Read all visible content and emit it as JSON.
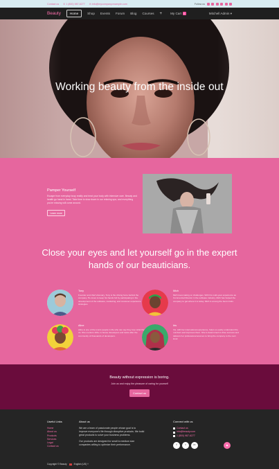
{
  "topbar": {
    "contact_label": "Contact us",
    "phone": "1 (800) 987-6277",
    "email": "info@mycompany.example.com",
    "follow_label": "Follow us"
  },
  "navbar": {
    "brand": "Beauty",
    "items": [
      "Home",
      "Shop",
      "Events",
      "Forum",
      "Blog",
      "Courses"
    ],
    "plus": "+",
    "cart_label": "My Cart",
    "cart_count": "0",
    "user": "Mitchell Admin"
  },
  "hero": {
    "title": "Working beauty from the inside out"
  },
  "pamper": {
    "title": "Pamper Yourself",
    "text": "Escape from everyday busy reality and treat your body with intensive care. Beauty and health go hand in hand. Take time to slow down in our relaxing spa, and everything you're missing will come around.",
    "button": "Learn more"
  },
  "quote": "Close your eyes and let yourself go in the expert hands of our beauticians.",
  "team": [
    {
      "name": "Tony",
      "desc": "Founder and chief visionary, Tony is the driving force behind the company. He loves to keep his hands full by participating in the development of the software, marketing, and customer experience strategies."
    },
    {
      "name": "Mich",
      "desc": "Mich loves taking on challenges. With his multi-year experience as Commercial Director in the software industry, Mich has helped the company to get where it is today. Mich is among the best minds."
    },
    {
      "name": "Aline",
      "desc": "Aline is one of the iconic people in life who can say they love what they do. She mentors 100+ in-house developers and looks after the community of thousands of developers."
    },
    {
      "name": "Iris",
      "desc": "Iris, with her international experience, helps us easily understand the numbers and improves them. She is determined to drive success and delivers her professional acumen to bring the company to the next level."
    }
  ],
  "cta": {
    "title": "Beauty without expression is boring.",
    "subtitle": "Join us and enjoy the pleasure of caring for yourself",
    "button": "Contact us"
  },
  "footer": {
    "links_title": "Useful Links",
    "links": [
      "Home",
      "About us",
      "Products",
      "Services",
      "Legal",
      "Contact us"
    ],
    "about_title": "About us",
    "about_p1": "We are a team of passionate people whose goal is to improve everyone's life through disruptive products. We build great products to solve your business problems.",
    "about_p2": "Our products are designed for small to medium size companies willing to optimize their performance.",
    "connect_title": "Connect with us",
    "connect": [
      "Contact us",
      "info@beauty.com",
      "1 (800) 987-6277"
    ],
    "social": [
      "f",
      "t",
      "in"
    ],
    "copyright": "Copyright © Beauty",
    "language": "English (US) ˅",
    "to_top": "▲"
  },
  "colors": {
    "accent": "#e6669e",
    "dark": "#1f1f1f",
    "cta_bg": "#6a0c3c",
    "footer_bg": "#252525"
  }
}
